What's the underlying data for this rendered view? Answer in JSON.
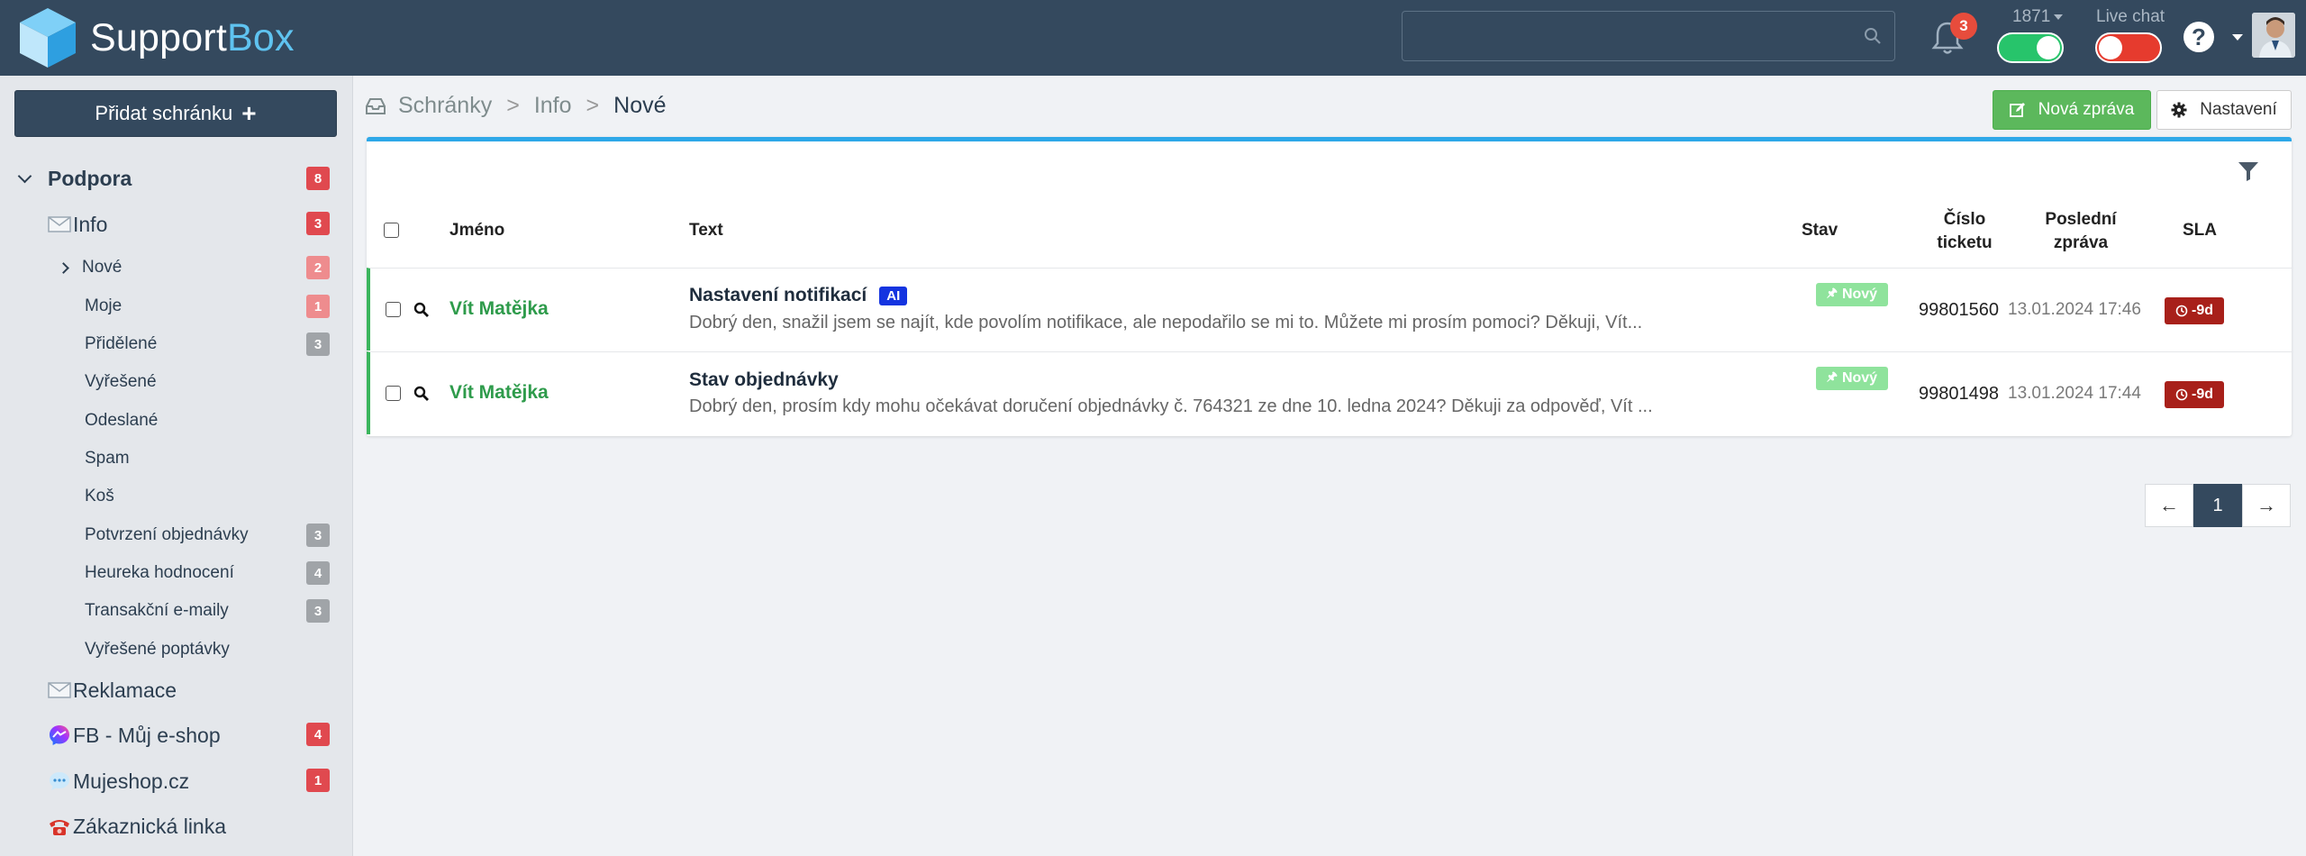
{
  "app": {
    "logo_text_1": "Support",
    "logo_text_2": "Box"
  },
  "header": {
    "notifications_count": "3",
    "counter_label": "1871",
    "livechat_label": "Live chat",
    "help_label": "?"
  },
  "sidebar": {
    "add_inbox_label": "Přidat schránku",
    "group": {
      "label": "Podpora",
      "count": "8"
    },
    "inbox_info": {
      "label": "Info",
      "count": "3"
    },
    "folders": [
      {
        "label": "Nové",
        "count": "2"
      },
      {
        "label": "Moje",
        "count": "1"
      },
      {
        "label": "Přidělené",
        "count": "3"
      },
      {
        "label": "Vyřešené",
        "count": ""
      },
      {
        "label": "Odeslané",
        "count": ""
      },
      {
        "label": "Spam",
        "count": ""
      },
      {
        "label": "Koš",
        "count": ""
      },
      {
        "label": "Potvrzení objednávky",
        "count": "3"
      },
      {
        "label": "Heureka hodnocení",
        "count": "4"
      },
      {
        "label": "Transakční e-maily",
        "count": "3"
      },
      {
        "label": "Vyřešené poptávky",
        "count": ""
      }
    ],
    "other_inboxes": [
      {
        "label": "Reklamace",
        "count": "",
        "icon": "envelope-icon"
      },
      {
        "label": "FB - Můj e-shop",
        "count": "4",
        "icon": "messenger-icon"
      },
      {
        "label": "Mujeshop.cz",
        "count": "1",
        "icon": "chat-bubble-icon"
      },
      {
        "label": "Zákaznická linka",
        "count": "",
        "icon": "phone-icon"
      }
    ]
  },
  "breadcrumb": {
    "root": "Schránky",
    "inbox": "Info",
    "current": "Nové",
    "sep": ">"
  },
  "toolbar": {
    "new_message": "Nová zpráva",
    "settings": "Nastavení"
  },
  "table": {
    "headers": {
      "name": "Jméno",
      "text": "Text",
      "status": "Stav",
      "ticket_1": "Číslo",
      "ticket_2": "ticketu",
      "last_1": "Poslední",
      "last_2": "zpráva",
      "sla": "SLA"
    },
    "rows": [
      {
        "name": "Vít Matějka",
        "subject": "Nastavení notifikací",
        "ai": "AI",
        "snippet": "Dobrý den, snažil jsem se najít, kde povolím notifikace, ale nepodařilo se mi to. Můžete mi prosím pomoci? Děkuji, Vít...",
        "status": "Nový",
        "ticket": "99801560",
        "last": "13.01.2024 17:46",
        "sla": "-9d"
      },
      {
        "name": "Vít Matějka",
        "subject": "Stav objednávky",
        "ai": "",
        "snippet": "Dobrý den, prosím kdy mohu očekávat doručení objednávky č. 764321 ze dne 10. ledna 2024? Děkuji za odpověď, Vít ...",
        "status": "Nový",
        "ticket": "99801498",
        "last": "13.01.2024 17:44",
        "sla": "-9d"
      }
    ]
  },
  "pagination": {
    "prev": "←",
    "page": "1",
    "next": "→"
  },
  "colors": {
    "header_bg": "#34495e",
    "accent_blue": "#2ea8e8",
    "green": "#5cb85c",
    "red": "#e0494f",
    "sla_red": "#a8201a"
  }
}
